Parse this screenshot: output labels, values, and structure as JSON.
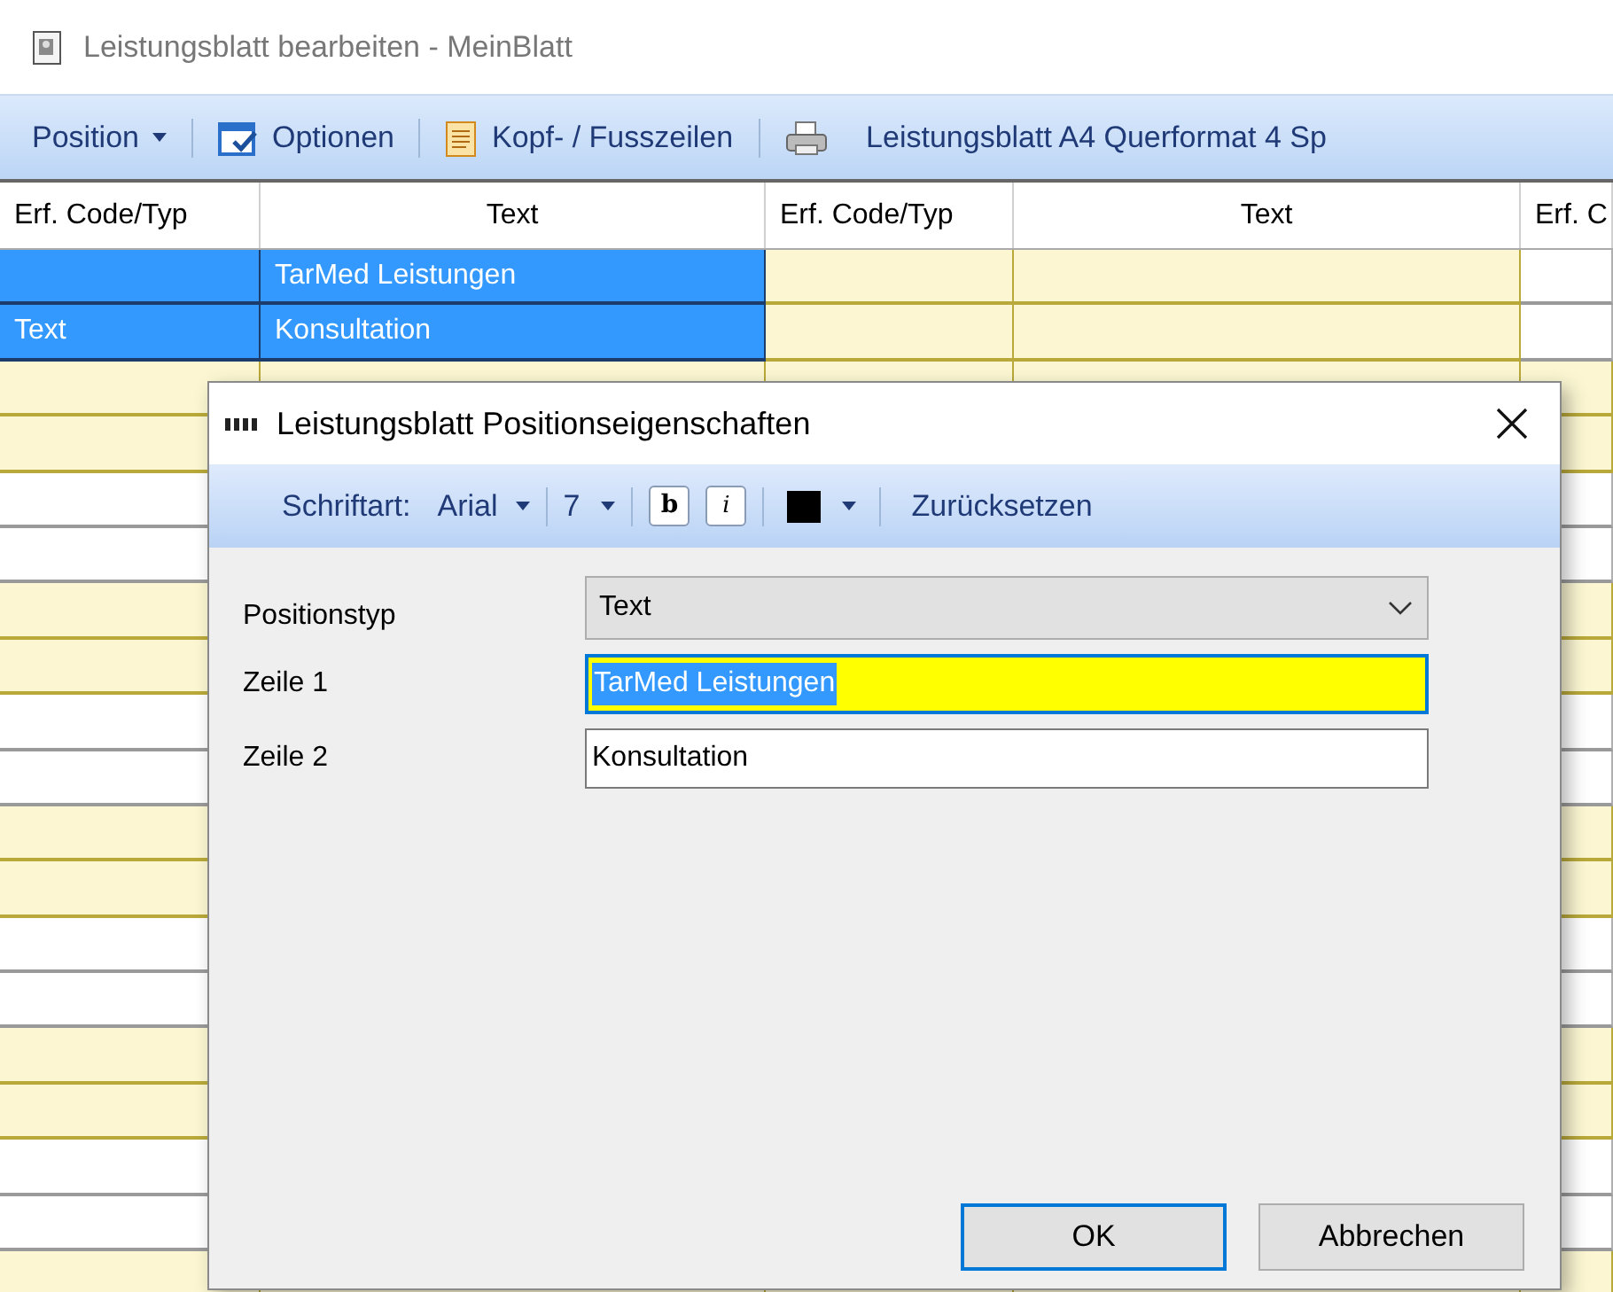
{
  "window": {
    "title": "Leistungsblatt bearbeiten - MeinBlatt"
  },
  "toolbar": [
    {
      "kind": "menu",
      "label": "Position"
    },
    {
      "kind": "options",
      "label": "Optionen"
    },
    {
      "kind": "header",
      "label": "Kopf- / Fusszeilen"
    },
    {
      "kind": "print",
      "label": "Leistungsblatt A4 Querformat 4 Sp"
    }
  ],
  "table": {
    "columns": [
      "Erf. Code/Typ",
      "Text",
      "Erf. Code/Typ",
      "Text",
      "Erf. C"
    ],
    "rows": [
      {
        "selected": true,
        "highlighted": true,
        "cells": [
          null,
          "TarMed Leistungen"
        ]
      },
      {
        "selected": true,
        "highlighted": true,
        "cells": [
          "Text",
          "Konsultation"
        ]
      },
      {
        "selected": false,
        "highlighted": true,
        "cells": []
      },
      {
        "selected": false,
        "highlighted": true,
        "cells": []
      },
      {
        "selected": false,
        "highlighted": false,
        "cells": []
      },
      {
        "selected": false,
        "highlighted": false,
        "cells": []
      },
      {
        "selected": false,
        "highlighted": true,
        "cells": []
      },
      {
        "selected": false,
        "highlighted": true,
        "cells": []
      },
      {
        "selected": false,
        "highlighted": false,
        "cells": []
      },
      {
        "selected": false,
        "highlighted": false,
        "cells": []
      },
      {
        "selected": false,
        "highlighted": true,
        "cells": []
      },
      {
        "selected": false,
        "highlighted": true,
        "cells": []
      },
      {
        "selected": false,
        "highlighted": false,
        "cells": []
      },
      {
        "selected": false,
        "highlighted": false,
        "cells": []
      },
      {
        "selected": false,
        "highlighted": true,
        "cells": []
      },
      {
        "selected": false,
        "highlighted": true,
        "cells": []
      },
      {
        "selected": false,
        "highlighted": false,
        "cells": []
      },
      {
        "selected": false,
        "highlighted": false,
        "cells": []
      },
      {
        "selected": false,
        "highlighted": true,
        "cells": []
      }
    ]
  },
  "dialog": {
    "title": "Leistungsblatt Positionseigenschaften",
    "toolbar": {
      "font_label": "Schriftart:",
      "font": "Arial",
      "size": "7",
      "bold": "b",
      "italic": "i",
      "color": "#000000",
      "reset": "Zurücksetzen"
    },
    "fields": [
      {
        "kind": "select",
        "label": "Positionstyp",
        "value": "Text"
      },
      {
        "kind": "input",
        "label": "Zeile 1",
        "value": "TarMed Leistungen",
        "focused": true
      },
      {
        "kind": "input",
        "label": "Zeile 2",
        "value": "Konsultation",
        "focused": false
      }
    ],
    "buttons": [
      {
        "label": "OK",
        "default": true
      },
      {
        "label": "Abbrechen",
        "default": false
      }
    ]
  }
}
